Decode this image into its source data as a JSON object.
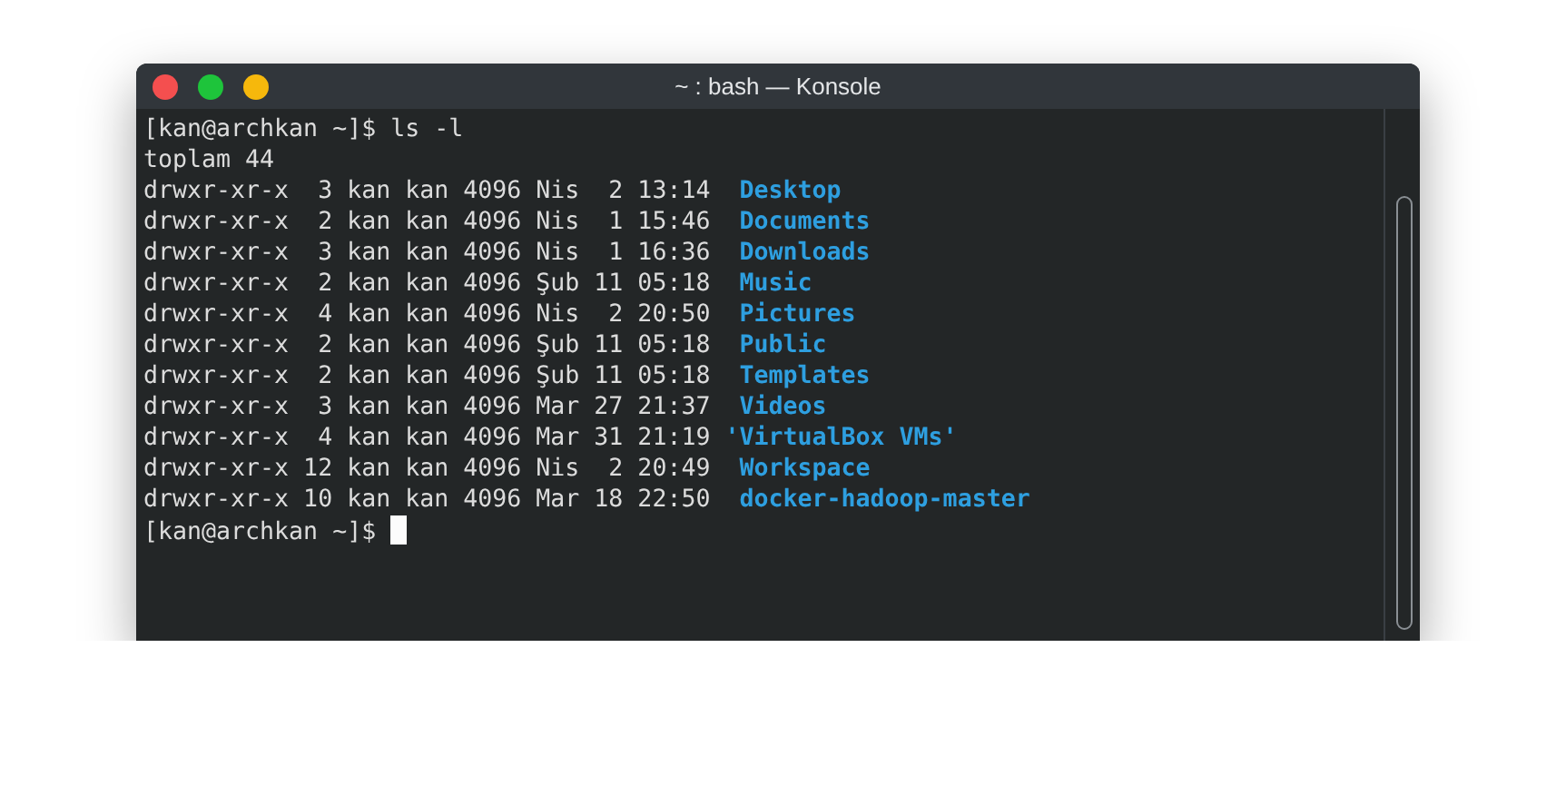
{
  "window": {
    "title": "~ : bash — Konsole"
  },
  "lines": [
    {
      "kind": "prompt",
      "prompt": "[kan@archkan ~]$",
      "command": "ls -l"
    },
    {
      "kind": "text",
      "text": "toplam 44"
    },
    {
      "kind": "entry",
      "info": "drwxr-xr-x  3 kan kan 4096 Nis  2 13:14  ",
      "name": "Desktop"
    },
    {
      "kind": "entry",
      "info": "drwxr-xr-x  2 kan kan 4096 Nis  1 15:46  ",
      "name": "Documents"
    },
    {
      "kind": "entry",
      "info": "drwxr-xr-x  3 kan kan 4096 Nis  1 16:36  ",
      "name": "Downloads"
    },
    {
      "kind": "entry",
      "info": "drwxr-xr-x  2 kan kan 4096 Şub 11 05:18  ",
      "name": "Music"
    },
    {
      "kind": "entry",
      "info": "drwxr-xr-x  4 kan kan 4096 Nis  2 20:50  ",
      "name": "Pictures"
    },
    {
      "kind": "entry",
      "info": "drwxr-xr-x  2 kan kan 4096 Şub 11 05:18  ",
      "name": "Public"
    },
    {
      "kind": "entry",
      "info": "drwxr-xr-x  2 kan kan 4096 Şub 11 05:18  ",
      "name": "Templates"
    },
    {
      "kind": "entry",
      "info": "drwxr-xr-x  3 kan kan 4096 Mar 27 21:37  ",
      "name": "Videos"
    },
    {
      "kind": "entry",
      "info": "drwxr-xr-x  4 kan kan 4096 Mar 31 21:19 ",
      "name": "'VirtualBox VMs'"
    },
    {
      "kind": "entry",
      "info": "drwxr-xr-x 12 kan kan 4096 Nis  2 20:49  ",
      "name": "Workspace"
    },
    {
      "kind": "entry",
      "info": "drwxr-xr-x 10 kan kan 4096 Mar 18 22:50  ",
      "name": "docker-hadoop-master"
    },
    {
      "kind": "prompt",
      "prompt": "[kan@archkan ~]$",
      "cursor": true
    }
  ]
}
